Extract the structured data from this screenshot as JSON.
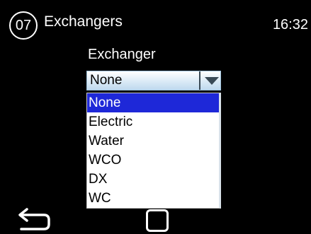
{
  "header": {
    "page_number": "07",
    "title": "Exchangers",
    "time": "16:32"
  },
  "field": {
    "label": "Exchanger",
    "selected_value": "None"
  },
  "dropdown": {
    "options": [
      "None",
      "Electric",
      "Water",
      "WCO",
      "DX",
      "WC"
    ],
    "selected_index": 0
  },
  "footer": {
    "back_icon": "back-arrow-icon",
    "home_icon": "home-square-icon"
  },
  "colors": {
    "background": "#000000",
    "highlight": "#1e28d8",
    "select_gradient_top": "#ffffff",
    "select_gradient_bottom": "#bfd9ee"
  }
}
